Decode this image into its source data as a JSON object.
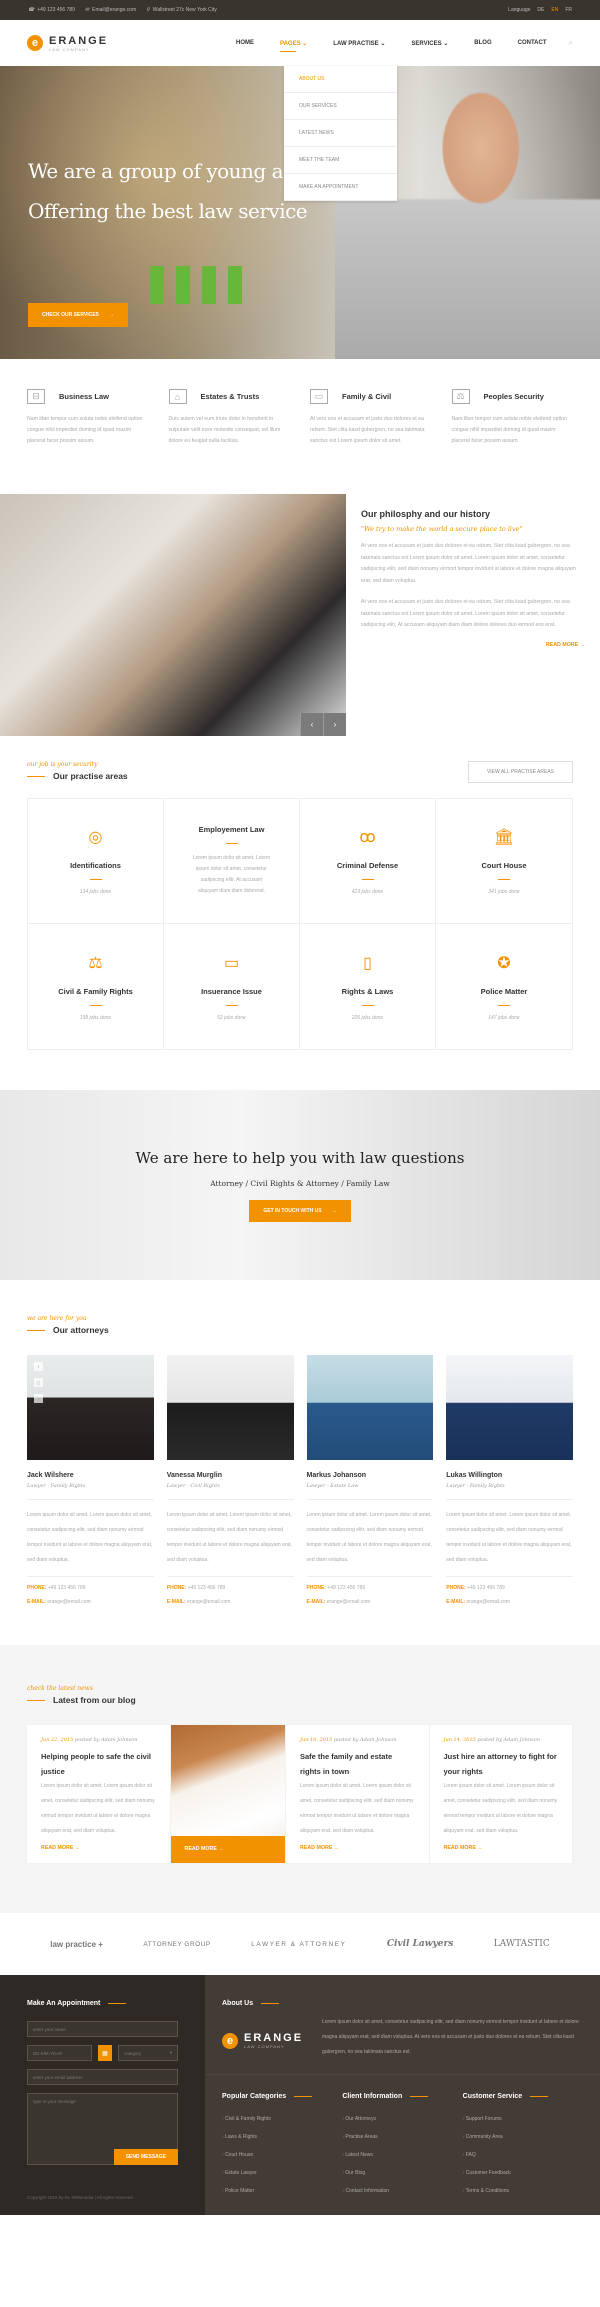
{
  "topbar": {
    "phone": "+49 123 456 789",
    "email": "Email@erange.com",
    "address": "Wallstreet 27c New York City",
    "language_label": "Language",
    "languages": [
      "DE",
      "EN",
      "FR"
    ],
    "active_language": "EN"
  },
  "brand": {
    "name": "ERANGE",
    "tagline": "LAW COMPANY",
    "accent_color": "#f39200"
  },
  "nav": {
    "items": [
      "HOME",
      "PAGES",
      "LAW PRACTISE",
      "SERVICES",
      "BLOG",
      "CONTACT"
    ],
    "active": "PAGES",
    "dropdown": [
      "ABOUT US",
      "OUR SERVICES",
      "LATEST NEWS",
      "MEET THE TEAM",
      "MAKE AN APPOINTMENT"
    ],
    "dropdown_active": "ABOUT US"
  },
  "hero": {
    "line1": "We are a group of young a",
    "line2": "Offering the best law service",
    "button": "CHECK OUR SERVICES"
  },
  "features": [
    {
      "title": "Business Law",
      "icon": "briefcase-icon",
      "text": "Nam liber tempor cum soluta nobis eleifend option congue nihil imperdiet doming id quod mazim placerat facer possim assum."
    },
    {
      "title": "Estates & Trusts",
      "icon": "building-icon",
      "text": "Duis autem vel eum iriure dolor in hendrerit in vulputate velit esse molestie consequat, vel illum dolore eu feugiat nulla facilisis."
    },
    {
      "title": "Family & Civil",
      "icon": "wallet-icon",
      "text": "At vero eos et accusam et justo duo dolores et ea rebum. Stet clita kasd gubergren, no sea takimata sanctus est Lorem ipsum dolor sit amet."
    },
    {
      "title": "Peoples Security",
      "icon": "scales-icon",
      "text": "Nam liber tempor cum soluta nobis eleifend option congue nihil imperdiet doming id quod mazim placerat facer possim assum."
    }
  ],
  "philosophy": {
    "title": "Our philosphy and our history",
    "quote": "\"We try to make the world a secure place to live\"",
    "p1": "At vero eos et accusam et justo duo dolores et ea rebum. Stet clita kasd gubergren, no sea takimata sanctus est Lorem ipsum dolor sit amet. Lorem ipsum dolor sit amet, consetetur sadipscing elitr, sed diam nonumy eirmod tempor invidunt ut labore et dolore magna aliquyam erat, sed diam voluptua.",
    "p2": "At vero eos et accusam et justo duo dolores et ea rebum. Stet clita kasd gubergren, no sea takimata sanctus est Lorem ipsum dolor sit amet. Lorem ipsum dolor sit amet, consetetur sadipscing elitr, At accusam aliquyam diam diam dolore dolores duo eirmod eos erat.",
    "read_more": "READ MORE"
  },
  "practice": {
    "kicker": "our job is your security",
    "title": "Our practise areas",
    "view_all": "VIEW ALL PRACTISE AREAS",
    "areas": [
      {
        "name": "Identifications",
        "jobs": "134 jobs done",
        "icon": "fingerprint-icon",
        "glyph": "◎"
      },
      {
        "name": "Employement Law",
        "desc": "Lorem ipsum dolor sit amet. Lorem ipsum dolor sit amet, consetetur sadipscing elitr. At accusam aliquyam diam diam dolorerat."
      },
      {
        "name": "Criminal Defense",
        "jobs": "423 jobs done",
        "icon": "handcuffs-icon",
        "glyph": "ꝏ"
      },
      {
        "name": "Court House",
        "jobs": "341 jobs done",
        "icon": "courthouse-icon",
        "glyph": "🏛"
      },
      {
        "name": "Civil & Family Rights",
        "jobs": "198 jobs done",
        "icon": "scales-icon",
        "glyph": "⚖"
      },
      {
        "name": "Insuerance Issue",
        "jobs": "52 jobs done",
        "icon": "wallet-icon",
        "glyph": "▭"
      },
      {
        "name": "Rights & Laws",
        "jobs": "226 jobs done",
        "icon": "book-icon",
        "glyph": "▯"
      },
      {
        "name": "Police Matter",
        "jobs": "147 jobs done",
        "icon": "badge-icon",
        "glyph": "✪"
      }
    ]
  },
  "cta": {
    "title": "We are here to help you with law questions",
    "subtitle": "Attorney / Civil Rights & Attorney / Family Law",
    "button": "GET IN TOUCH WITH US"
  },
  "attorneys": {
    "kicker": "we are here for you",
    "title": "Our attorneys",
    "phone_label": "PHONE:",
    "email_label": "E-MAIL:",
    "bio": "Lorem ipsum dolor sit amet. Lorem ipsum dolor sit amet, consetetur sadipscing elitr, sed diam nonumy eirmod tempor invidunt ut labore et dolore magna aliquyam erat, sed diam voluptua.",
    "people": [
      {
        "name": "Jack Wilshere",
        "role": "Lawyer - Family Rights",
        "phone": "+49 123 456 789",
        "email": "erange@email.com"
      },
      {
        "name": "Vanessa Murglin",
        "role": "Lawyer - Civil Rights",
        "phone": "+49 123 456 789",
        "email": "erange@email.com"
      },
      {
        "name": "Markus Johanson",
        "role": "Lawyer - Estate Law",
        "phone": "+49 123 456 789",
        "email": "erange@email.com"
      },
      {
        "name": "Lukas Willington",
        "role": "Lawyer - Family Rights",
        "phone": "+49 123 456 789",
        "email": "erange@email.com"
      }
    ]
  },
  "blog": {
    "kicker": "check the latest news",
    "title": "Latest from our blog",
    "read_more": "READ MORE",
    "excerpt": "Lorem ipsum dolor sit amet. Lorem ipsum dolor sit amet, consetetur sadipscing elitr, sed diam nonumy eirmod tempor invidunt ut labore et dolore magna aliquyam erat, sed diam voluptua.",
    "posts": [
      {
        "date": "Jun 22, 2015",
        "by": "posted by Adam Johnson",
        "title": "Helping people to safe the civil justice"
      },
      {
        "image": true
      },
      {
        "date": "Jun 16, 2015",
        "by": "posted by Adam Johnson",
        "title": "Safe the family and estate rights in town"
      },
      {
        "date": "Jun 14, 2015",
        "by": "posted by Adam Johnson",
        "title": "Just hire an attorney to fight for your rights"
      }
    ]
  },
  "partners": [
    "law practice +",
    "ATTORNEY GROUP",
    "LAWYER & ATTORNEY",
    "Civil Lawyers",
    "LAWTASTIC"
  ],
  "footer": {
    "appointment": {
      "title": "Make An Appointment",
      "name_ph": "enter your name",
      "date_ph": "DD-MM-YEAR",
      "category_ph": "category",
      "email_ph": "enter your email address",
      "message_ph": "type in your message",
      "send": "SEND MESSAGE"
    },
    "copyright": "Copyright 2015 by KL-Webmedia | All rights reserved",
    "about_title": "About Us",
    "about_text": "Lorem ipsum dolor sit amet, consetetur sadipscing elitr, sed diam nonumy eirmod tempor invidunt ut labore et dolore magna aliquyam erat, sed diam voluptua. At vero eos et accusam et justo duo dolores et ea rebum. Stet clita kasd gubergren, no sea takimata sanctus est.",
    "columns": [
      {
        "title": "Popular Categories",
        "links": [
          "Civil & Family Rights",
          "Laws & Rights",
          "Court House",
          "Estate Lawyer",
          "Police Matter"
        ]
      },
      {
        "title": "Client Information",
        "links": [
          "Our Attorneys",
          "Practise Areas",
          "Latest News",
          "Our Blog",
          "Contact Information"
        ]
      },
      {
        "title": "Customer Service",
        "links": [
          "Support Forums",
          "Community Area",
          "FAQ",
          "Customer Feedback",
          "Terms & Conditions"
        ]
      }
    ]
  }
}
